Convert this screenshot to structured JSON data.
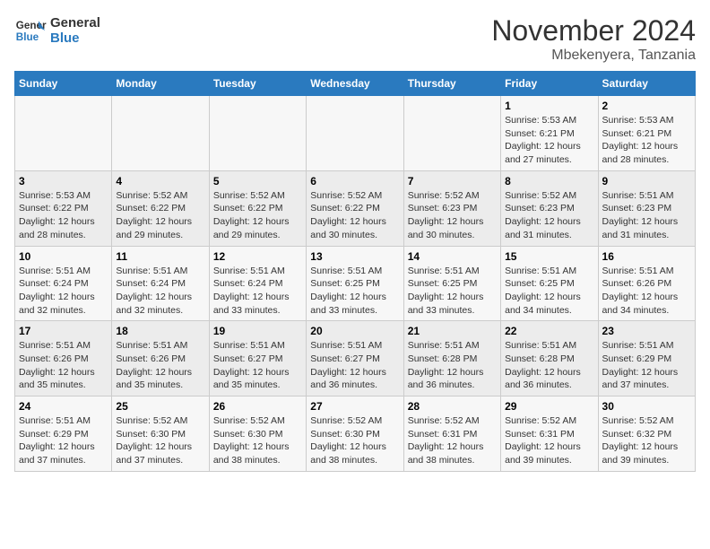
{
  "header": {
    "logo_line1": "General",
    "logo_line2": "Blue",
    "month": "November 2024",
    "location": "Mbekenyera, Tanzania"
  },
  "weekdays": [
    "Sunday",
    "Monday",
    "Tuesday",
    "Wednesday",
    "Thursday",
    "Friday",
    "Saturday"
  ],
  "weeks": [
    [
      {
        "day": "",
        "info": ""
      },
      {
        "day": "",
        "info": ""
      },
      {
        "day": "",
        "info": ""
      },
      {
        "day": "",
        "info": ""
      },
      {
        "day": "",
        "info": ""
      },
      {
        "day": "1",
        "info": "Sunrise: 5:53 AM\nSunset: 6:21 PM\nDaylight: 12 hours and 27 minutes."
      },
      {
        "day": "2",
        "info": "Sunrise: 5:53 AM\nSunset: 6:21 PM\nDaylight: 12 hours and 28 minutes."
      }
    ],
    [
      {
        "day": "3",
        "info": "Sunrise: 5:53 AM\nSunset: 6:22 PM\nDaylight: 12 hours and 28 minutes."
      },
      {
        "day": "4",
        "info": "Sunrise: 5:52 AM\nSunset: 6:22 PM\nDaylight: 12 hours and 29 minutes."
      },
      {
        "day": "5",
        "info": "Sunrise: 5:52 AM\nSunset: 6:22 PM\nDaylight: 12 hours and 29 minutes."
      },
      {
        "day": "6",
        "info": "Sunrise: 5:52 AM\nSunset: 6:22 PM\nDaylight: 12 hours and 30 minutes."
      },
      {
        "day": "7",
        "info": "Sunrise: 5:52 AM\nSunset: 6:23 PM\nDaylight: 12 hours and 30 minutes."
      },
      {
        "day": "8",
        "info": "Sunrise: 5:52 AM\nSunset: 6:23 PM\nDaylight: 12 hours and 31 minutes."
      },
      {
        "day": "9",
        "info": "Sunrise: 5:51 AM\nSunset: 6:23 PM\nDaylight: 12 hours and 31 minutes."
      }
    ],
    [
      {
        "day": "10",
        "info": "Sunrise: 5:51 AM\nSunset: 6:24 PM\nDaylight: 12 hours and 32 minutes."
      },
      {
        "day": "11",
        "info": "Sunrise: 5:51 AM\nSunset: 6:24 PM\nDaylight: 12 hours and 32 minutes."
      },
      {
        "day": "12",
        "info": "Sunrise: 5:51 AM\nSunset: 6:24 PM\nDaylight: 12 hours and 33 minutes."
      },
      {
        "day": "13",
        "info": "Sunrise: 5:51 AM\nSunset: 6:25 PM\nDaylight: 12 hours and 33 minutes."
      },
      {
        "day": "14",
        "info": "Sunrise: 5:51 AM\nSunset: 6:25 PM\nDaylight: 12 hours and 33 minutes."
      },
      {
        "day": "15",
        "info": "Sunrise: 5:51 AM\nSunset: 6:25 PM\nDaylight: 12 hours and 34 minutes."
      },
      {
        "day": "16",
        "info": "Sunrise: 5:51 AM\nSunset: 6:26 PM\nDaylight: 12 hours and 34 minutes."
      }
    ],
    [
      {
        "day": "17",
        "info": "Sunrise: 5:51 AM\nSunset: 6:26 PM\nDaylight: 12 hours and 35 minutes."
      },
      {
        "day": "18",
        "info": "Sunrise: 5:51 AM\nSunset: 6:26 PM\nDaylight: 12 hours and 35 minutes."
      },
      {
        "day": "19",
        "info": "Sunrise: 5:51 AM\nSunset: 6:27 PM\nDaylight: 12 hours and 35 minutes."
      },
      {
        "day": "20",
        "info": "Sunrise: 5:51 AM\nSunset: 6:27 PM\nDaylight: 12 hours and 36 minutes."
      },
      {
        "day": "21",
        "info": "Sunrise: 5:51 AM\nSunset: 6:28 PM\nDaylight: 12 hours and 36 minutes."
      },
      {
        "day": "22",
        "info": "Sunrise: 5:51 AM\nSunset: 6:28 PM\nDaylight: 12 hours and 36 minutes."
      },
      {
        "day": "23",
        "info": "Sunrise: 5:51 AM\nSunset: 6:29 PM\nDaylight: 12 hours and 37 minutes."
      }
    ],
    [
      {
        "day": "24",
        "info": "Sunrise: 5:51 AM\nSunset: 6:29 PM\nDaylight: 12 hours and 37 minutes."
      },
      {
        "day": "25",
        "info": "Sunrise: 5:52 AM\nSunset: 6:30 PM\nDaylight: 12 hours and 37 minutes."
      },
      {
        "day": "26",
        "info": "Sunrise: 5:52 AM\nSunset: 6:30 PM\nDaylight: 12 hours and 38 minutes."
      },
      {
        "day": "27",
        "info": "Sunrise: 5:52 AM\nSunset: 6:30 PM\nDaylight: 12 hours and 38 minutes."
      },
      {
        "day": "28",
        "info": "Sunrise: 5:52 AM\nSunset: 6:31 PM\nDaylight: 12 hours and 38 minutes."
      },
      {
        "day": "29",
        "info": "Sunrise: 5:52 AM\nSunset: 6:31 PM\nDaylight: 12 hours and 39 minutes."
      },
      {
        "day": "30",
        "info": "Sunrise: 5:52 AM\nSunset: 6:32 PM\nDaylight: 12 hours and 39 minutes."
      }
    ]
  ]
}
